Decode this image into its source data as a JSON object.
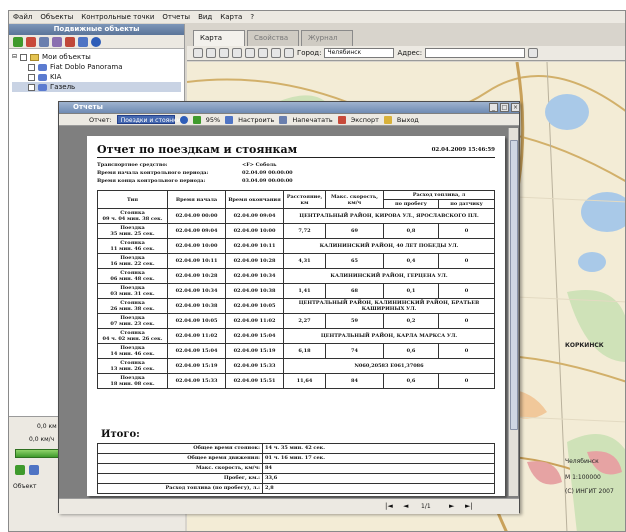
{
  "menubar": [
    "Файл",
    "Объекты",
    "Контрольные точки",
    "Отчеты",
    "Вид",
    "Карта",
    "?"
  ],
  "left_panel": {
    "title": "Подвижные объекты",
    "tree": [
      {
        "label": "Мои объекты",
        "level": 0,
        "selected": false
      },
      {
        "label": "Fiat Doblo Panorama",
        "level": 1,
        "selected": false
      },
      {
        "label": "KIA",
        "level": 1,
        "selected": false
      },
      {
        "label": "Газель",
        "level": 1,
        "selected": true
      }
    ],
    "bottom": {
      "speed1": "0,0 км",
      "speed2": "0,0 км/ч",
      "objects_label": "Объект"
    }
  },
  "map": {
    "tabs": [
      "Карта",
      "Свойства",
      "Журнал"
    ],
    "city_label": "Город:",
    "city_value": "Челябинск",
    "address_label": "Адрес:",
    "place_labels": [
      "КОРКИНСК",
      "Челябинск",
      "(С) ИНГИТ 2007"
    ],
    "scale_text": "М 1:100000"
  },
  "report": {
    "window_title": "Отчеты",
    "toolbar": {
      "report_label": "Отчет:",
      "report_value": "Поездки и стоянки",
      "zoom": "95%",
      "settings": "Настроить",
      "print": "Напечатать",
      "export": "Экспорт",
      "exit": "Выход"
    },
    "page": {
      "title": "Отчет по поездкам и стоянкам",
      "date": "02.04.2009 15:46:59",
      "meta": [
        {
          "label": "Транспортное средство:",
          "value": "<F> Соболь"
        },
        {
          "label": "Время начала контрольного периода:",
          "value": "02.04.09 00:00:00"
        },
        {
          "label": "Время конца контрольного периода:",
          "value": "03.04.09 00:00:00"
        }
      ],
      "headers": {
        "type": "Тип",
        "start": "Время начала",
        "end": "Время окончания",
        "distance": "Расстояние, км",
        "max_speed": "Макс. скорость, км/ч",
        "fuel": "Расход топлива, л",
        "fuel_mileage": "по пробегу",
        "fuel_sensor": "по датчику"
      },
      "rows": [
        {
          "type": "Стоянка",
          "dur": "09 ч. 04 мин. 38 сек.",
          "start": "02.04.09 00:00",
          "end": "02.04.09 09:04",
          "address": "ЦЕНТРАЛЬНЫЙ РАЙОН, КИРОВА УЛ., ЯРОСЛАВСКОГО ПЛ."
        },
        {
          "type": "Поездка",
          "dur": "35 мин. 25 сек.",
          "start": "02.04.09 09:04",
          "end": "02.04.09 10:00",
          "dist": "7,72",
          "speed": "69",
          "fuel_m": "0,8",
          "fuel_s": "0"
        },
        {
          "type": "Стоянка",
          "dur": "11 мин. 46 сек.",
          "start": "02.04.09 10:00",
          "end": "02.04.09 10:11",
          "address": "КАЛИНИНСКИЙ РАЙОН, 40 ЛЕТ ПОБЕДЫ УЛ."
        },
        {
          "type": "Поездка",
          "dur": "16 мин. 22 сек.",
          "start": "02.04.09 10:11",
          "end": "02.04.09 10:28",
          "dist": "4,31",
          "speed": "65",
          "fuel_m": "0,4",
          "fuel_s": "0"
        },
        {
          "type": "Стоянка",
          "dur": "06 мин. 48 сек.",
          "start": "02.04.09 10:28",
          "end": "02.04.09 10:34",
          "address": "КАЛИНИНСКИЙ РАЙОН, ГЕРЦЕНА УЛ."
        },
        {
          "type": "Поездка",
          "dur": "03 мин. 31 сек.",
          "start": "02.04.09 10:34",
          "end": "02.04.09 10:38",
          "dist": "1,41",
          "speed": "68",
          "fuel_m": "0,1",
          "fuel_s": "0"
        },
        {
          "type": "Стоянка",
          "dur": "26 мин. 38 сек.",
          "start": "02.04.09 10:38",
          "end": "02.04.09 10:05",
          "address": "ЦЕНТРАЛЬНЫЙ РАЙОН, КАЛИНИНСКИЙ РАЙОН, БРАТЬЕВ КАШИРИНЫХ УЛ."
        },
        {
          "type": "Поездка",
          "dur": "07 мин. 23 сек.",
          "start": "02.04.09 10:05",
          "end": "02.04.09 11:02",
          "dist": "2,27",
          "speed": "59",
          "fuel_m": "0,2",
          "fuel_s": "0"
        },
        {
          "type": "Стоянка",
          "dur": "04 ч. 02 мин. 26 сек.",
          "start": "02.04.09 11:02",
          "end": "02.04.09 15:04",
          "address": "ЦЕНТРАЛЬНЫЙ РАЙОН, КАРЛА МАРКСА УЛ."
        },
        {
          "type": "Поездка",
          "dur": "14 мин. 46 сек.",
          "start": "02.04.09 15:04",
          "end": "02.04.09 15:19",
          "dist": "6,18",
          "speed": "74",
          "fuel_m": "0,6",
          "fuel_s": "0"
        },
        {
          "type": "Стоянка",
          "dur": "13 мин. 26 сек.",
          "start": "02.04.09 15:19",
          "end": "02.04.09 15:33",
          "address": "N060,20583 E061,37086"
        },
        {
          "type": "Поездка",
          "dur": "18 мин. 08 сек.",
          "start": "02.04.09 15:33",
          "end": "02.04.09 15:51",
          "dist": "11,64",
          "speed": "84",
          "fuel_m": "0,6",
          "fuel_s": "0"
        }
      ],
      "itogo": "Итого:",
      "summary": [
        {
          "label": "Общее время стоянок:",
          "value": "14 ч. 35 мин. 42 сек."
        },
        {
          "label": "Общее время движения:",
          "value": "01 ч. 16 мин. 17 сек."
        },
        {
          "label": "Макс. скорость, км/ч:",
          "value": "84"
        },
        {
          "label": "Пробег, км.:",
          "value": "33,6"
        },
        {
          "label": "Расход топлива (по пробегу), л.:",
          "value": "2,8"
        }
      ]
    },
    "status": {
      "page": "1/1"
    }
  }
}
